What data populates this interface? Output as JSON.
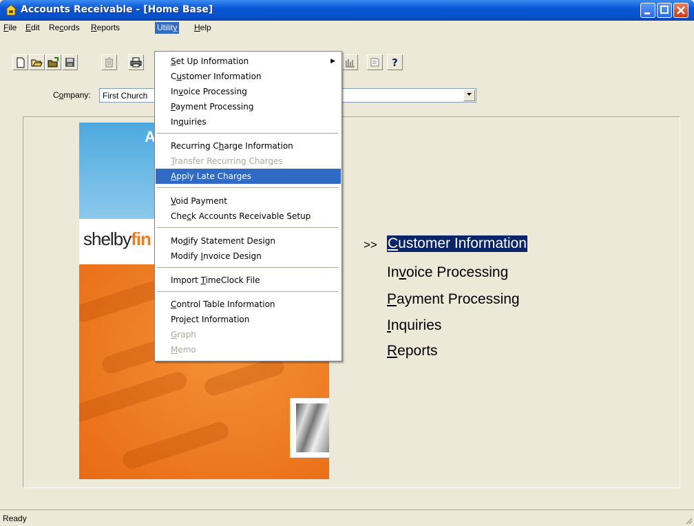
{
  "window": {
    "title": "Accounts Receivable - [Home Base]"
  },
  "menubar": {
    "file": "File",
    "edit": "Edit",
    "records": "Records",
    "reports": "Reports",
    "utility": "Utility",
    "help": "Help"
  },
  "toolbar": {
    "help_glyph": "?"
  },
  "company": {
    "label": "Company:",
    "value": "First Church"
  },
  "splash": {
    "top_text": "A",
    "logo_prefix": "shelby",
    "logo_suffix": "fin"
  },
  "nav": {
    "arrow": ">>",
    "items": [
      "Customer Information",
      "Invoice Processing",
      "Payment Processing",
      "Inquiries",
      "Reports"
    ]
  },
  "utility_menu": {
    "items": [
      "Set Up Information",
      "Customer Information",
      "Invoice Processing",
      "Payment Processing",
      "Inquiries",
      "Recurring Charge Information",
      "Transfer Recurring Charges",
      "Apply Late Charges",
      "Void Payment",
      "Check Accounts Receivable Setup",
      "Modify Statement Design",
      "Modify Invoice Design",
      "Import TimeClock File",
      "Control Table Information",
      "Project Information",
      "Graph",
      "Memo"
    ],
    "highlighted": "Apply Late Charges",
    "disabled": [
      "Transfer Recurring Charges",
      "Graph",
      "Memo"
    ]
  },
  "status": {
    "text": "Ready"
  },
  "colors": {
    "titlebar": "#0a56d8",
    "menu_highlight": "#316ac5",
    "nav_highlight": "#0a246a",
    "splash_orange": "#f07c1a",
    "splash_blue": "#4da9dd"
  }
}
